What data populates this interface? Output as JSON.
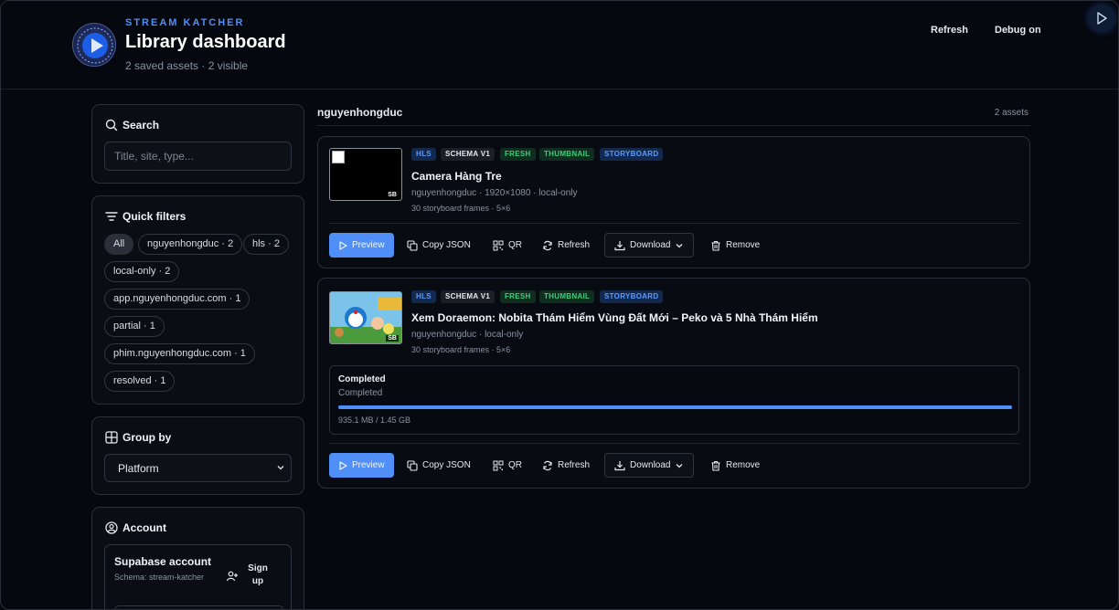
{
  "header": {
    "brand": "STREAM KATCHER",
    "title": "Library dashboard",
    "subtitle": "2 saved assets · 2 visible",
    "refresh_label": "Refresh",
    "debug_label": "Debug on"
  },
  "sidebar": {
    "search": {
      "title": "Search",
      "placeholder": "Title, site, type..."
    },
    "filters": {
      "title": "Quick filters",
      "chips": [
        "All",
        "nguyenhongduc · 2",
        "hls · 2",
        "local-only · 2",
        "app.nguyenhongduc.com · 1",
        "partial · 1",
        "phim.nguyenhongduc.com · 1",
        "resolved · 1"
      ]
    },
    "group_by": {
      "title": "Group by",
      "selected": "Platform"
    },
    "account": {
      "title": "Account",
      "card_title": "Supabase account",
      "schema": "Schema: stream-katcher",
      "signup_label": "Sign up"
    }
  },
  "main": {
    "group_name": "nguyenhongduc",
    "group_count": "2 assets",
    "assets": [
      {
        "badges": [
          "HLS",
          "SCHEMA V1",
          "FRESH",
          "THUMBNAIL",
          "STORYBOARD"
        ],
        "thumb_tag": "SB",
        "title": "Camera Hàng Tre",
        "meta": "nguyenhongduc · 1920×1080 · local-only",
        "frames": "30 storyboard frames · 5×6"
      },
      {
        "badges": [
          "HLS",
          "SCHEMA V1",
          "FRESH",
          "THUMBNAIL",
          "STORYBOARD"
        ],
        "thumb_tag": "SB",
        "title": "Xem Doraemon: Nobita Thám Hiểm Vùng Đất Mới – Peko và 5 Nhà Thám Hiểm",
        "meta": "nguyenhongduc · local-only",
        "frames": "30 storyboard frames · 5×6",
        "progress": {
          "status": "Completed",
          "detail": "Completed",
          "fraction": 1.0,
          "size": "935.1 MB / 1.45 GB"
        }
      }
    ],
    "actions": {
      "preview": "Preview",
      "copy_json": "Copy JSON",
      "qr": "QR",
      "refresh": "Refresh",
      "download": "Download",
      "remove": "Remove"
    }
  },
  "colors": {
    "accent": "#4f8ff7",
    "background": "#05080f",
    "badge_green": "#3ecf7a"
  }
}
